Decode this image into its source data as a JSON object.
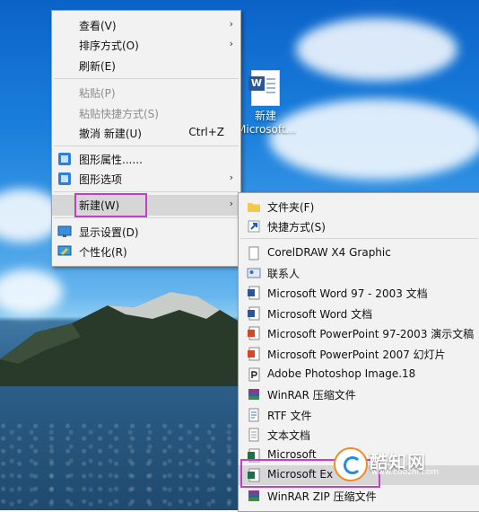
{
  "desktop_icon": {
    "line1": "新建",
    "line2": "Microsoft..."
  },
  "main_menu": [
    {
      "label": "查看(V)",
      "arrow": "›"
    },
    {
      "label": "排序方式(O)",
      "arrow": "›"
    },
    {
      "label": "刷新(E)"
    },
    {
      "label": "粘贴(P)",
      "disabled": true
    },
    {
      "label": "粘贴快捷方式(S)",
      "disabled": true
    },
    {
      "label": "撤消 新建(U)",
      "shortcut": "Ctrl+Z"
    },
    {
      "label": "图形属性......"
    },
    {
      "label": "图形选项",
      "arrow": "›"
    },
    {
      "label": "新建(W)",
      "arrow": "›"
    },
    {
      "label": "显示设置(D)"
    },
    {
      "label": "个性化(R)"
    }
  ],
  "sub_menu": [
    {
      "label": "文件夹(F)",
      "icon": "folder-icon"
    },
    {
      "label": "快捷方式(S)",
      "icon": "shortcut-icon"
    },
    {
      "label": "CorelDRAW X4 Graphic",
      "icon": "coreldraw-file-icon"
    },
    {
      "label": "联系人",
      "icon": "contact-icon"
    },
    {
      "label": "Microsoft Word 97 - 2003 文档",
      "icon": "word-doc-icon"
    },
    {
      "label": "Microsoft Word 文档",
      "icon": "word-docx-icon"
    },
    {
      "label": "Microsoft PowerPoint 97-2003 演示文稿",
      "icon": "ppt-icon"
    },
    {
      "label": "Microsoft PowerPoint 2007 幻灯片",
      "icon": "pptx-icon"
    },
    {
      "label": "Adobe Photoshop Image.18",
      "icon": "photoshop-icon"
    },
    {
      "label": "WinRAR 压缩文件",
      "icon": "winrar-icon"
    },
    {
      "label": "RTF 文件",
      "icon": "rtf-icon"
    },
    {
      "label": "文本文档",
      "icon": "text-doc-icon"
    },
    {
      "label": "Microsoft",
      "icon": "excel-icon"
    },
    {
      "label": "Microsoft Ex",
      "icon": "excel-xlsx-icon"
    },
    {
      "label": "WinRAR ZIP 压缩文件",
      "icon": "winrar-zip-icon"
    }
  ],
  "watermark": {
    "name": "酷知网",
    "url": "www.coozhi.com"
  },
  "colors": {
    "highlight_outline": "#c53ec6",
    "menu_bg": "#f2f2f2"
  }
}
